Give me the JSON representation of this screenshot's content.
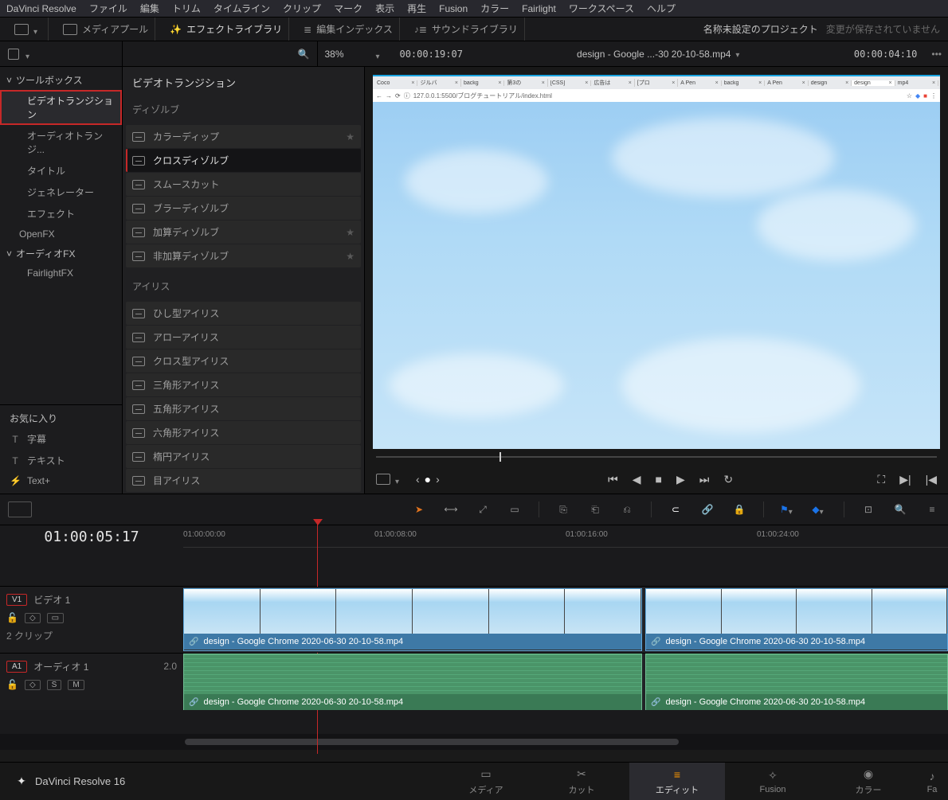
{
  "menu": [
    "DaVinci Resolve",
    "ファイル",
    "編集",
    "トリム",
    "タイムライン",
    "クリップ",
    "マーク",
    "表示",
    "再生",
    "Fusion",
    "カラー",
    "Fairlight",
    "ワークスペース",
    "ヘルプ"
  ],
  "toolbar": {
    "mediapool": "メディアプール",
    "fxlib": "エフェクトライブラリ",
    "editindex": "編集インデックス",
    "soundlib": "サウンドライブラリ",
    "project": "名称未設定のプロジェクト",
    "unsaved": "変更が保存されていません"
  },
  "viewbar": {
    "zoom": "38%",
    "timecode_src": "00:00:19:07",
    "clipname": "design - Google ...-30 20-10-58.mp4",
    "timecode_rec": "00:00:04:10"
  },
  "sidebar": {
    "toolbox_head": "ツールボックス",
    "items": [
      "ビデオトランジション",
      "オーディオトランジ...",
      "タイトル",
      "ジェネレーター",
      "エフェクト"
    ],
    "openfx": "OpenFX",
    "audiofx_head": "オーディオFX",
    "audiofx_items": [
      "FairlightFX"
    ],
    "fav_head": "お気に入り",
    "fav_items": [
      {
        "icon": "T",
        "label": "字幕"
      },
      {
        "icon": "T",
        "label": "テキスト"
      },
      {
        "icon": "⚡",
        "label": "Text+"
      }
    ]
  },
  "fx": {
    "title": "ビデオトランジション",
    "group1": "ディゾルブ",
    "group1items": [
      "カラーディップ",
      "クロスディゾルブ",
      "スムースカット",
      "ブラーディゾルブ",
      "加算ディゾルブ",
      "非加算ディゾルブ"
    ],
    "group2": "アイリス",
    "group2items": [
      "ひし型アイリス",
      "アローアイリス",
      "クロス型アイリス",
      "三角形アイリス",
      "五角形アイリス",
      "六角形アイリス",
      "楕円アイリス",
      "目アイリス"
    ]
  },
  "browser_tabs": [
    "Coco",
    "ジルバ",
    "backg",
    "第3の",
    "[CSS]",
    "広告は",
    "[プロ",
    "A Pen",
    "backg",
    "A Pen",
    "design",
    "design",
    "mp4"
  ],
  "browser_url": "127.0.0.1:5500/ブログチュートリアル/index.html",
  "timeline": {
    "tc": "01:00:05:17",
    "ticks": [
      "01:00:00:00",
      "01:00:08:00",
      "01:00:16:00",
      "01:00:24:00"
    ],
    "video_track": {
      "tag": "V1",
      "name": "ビデオ 1",
      "clipcount": "2 クリップ"
    },
    "audio_track": {
      "tag": "A1",
      "name": "オーディオ 1",
      "level": "2.0"
    },
    "clip_name": "design - Google Chrome 2020-06-30 20-10-58.mp4"
  },
  "pages": {
    "brand": "DaVinci Resolve 16",
    "tabs": [
      "メディア",
      "カット",
      "エディット",
      "Fusion",
      "カラー",
      "Fa"
    ]
  }
}
